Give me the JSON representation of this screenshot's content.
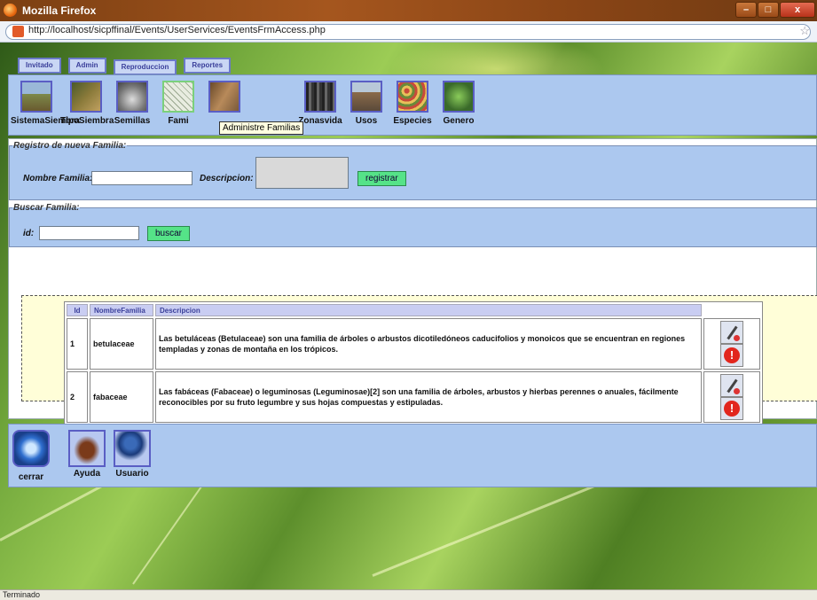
{
  "window": {
    "title": "Mozilla Firefox",
    "minimize": "–",
    "maximize": "□",
    "close": "x"
  },
  "address_bar": {
    "url": "http://localhost/sicpffinal/Events/UserServices/EventsFrmAccess.php"
  },
  "nav_tabs": [
    "Invitado",
    "Admin",
    "Reproduccion",
    "Reportes"
  ],
  "menu": {
    "items": [
      {
        "label": "SistemaSiembra",
        "icon": "field-photo-icon",
        "color": "#7d8a4a"
      },
      {
        "label": "TipoSiembra",
        "icon": "cows-photo-icon",
        "color": "#8a7a3a"
      },
      {
        "label": "Semillas",
        "icon": "hands-seeds-icon",
        "color": "#9a9a9a"
      },
      {
        "label": "Fami",
        "icon": "plants-drawing-icon",
        "color": "#d8dcc8"
      },
      {
        "label": "",
        "icon": "soil-photo-icon",
        "color": "#8a5a3a"
      },
      {
        "label": "Zonasvida",
        "icon": "forest-photo-icon",
        "color": "#3a3a3a"
      },
      {
        "label": "Usos",
        "icon": "logs-photo-icon",
        "color": "#7a6a4a"
      },
      {
        "label": "Especies",
        "icon": "flowers-photo-icon",
        "color": "#b07a4a"
      },
      {
        "label": "Genero",
        "icon": "leaves-photo-icon",
        "color": "#5a8a3a"
      }
    ],
    "tooltip": "Administre Familias"
  },
  "registro": {
    "legend": "Registro de nueva Familia:",
    "nombre_label": "Nombre Familia:",
    "nombre_value": "",
    "descripcion_label": "Descripcion:",
    "descripcion_value": "",
    "submit": "registrar"
  },
  "buscar": {
    "legend": "Buscar Familia:",
    "id_label": "id:",
    "id_value": "",
    "submit": "buscar"
  },
  "table": {
    "headers": [
      "Id",
      "NombreFamilia",
      "Descripcion",
      ""
    ],
    "rows": [
      {
        "id": "1",
        "nombre": "betulaceae",
        "descripcion": "Las betuláceas (Betulaceae) son una familia de árboles o arbustos dicotiledóneos caducifolios y monoicos que se encuentran en regiones templadas y zonas de montaña en los trópicos."
      },
      {
        "id": "2",
        "nombre": "fabaceae",
        "descripcion": "Las fabáceas (Fabaceae) o leguminosas (Leguminosae)[2] son una familia de árboles, arbustos y hierbas perennes o anuales, fácilmente reconocibles por su fruto legumbre y sus hojas compuestas y estipuladas."
      }
    ],
    "delete_symbol": "!"
  },
  "bottom": {
    "items": [
      {
        "label": "cerrar",
        "icon": "power-icon"
      },
      {
        "label": "Ayuda",
        "icon": "bull-icon"
      },
      {
        "label": "Usuario",
        "icon": "user-tools-icon"
      }
    ]
  },
  "status": "Terminado",
  "colors": {
    "panel": "#acc8ef",
    "button_green": "#55e388",
    "results_bg": "#fffed8",
    "titlebar": "#a5561e"
  }
}
